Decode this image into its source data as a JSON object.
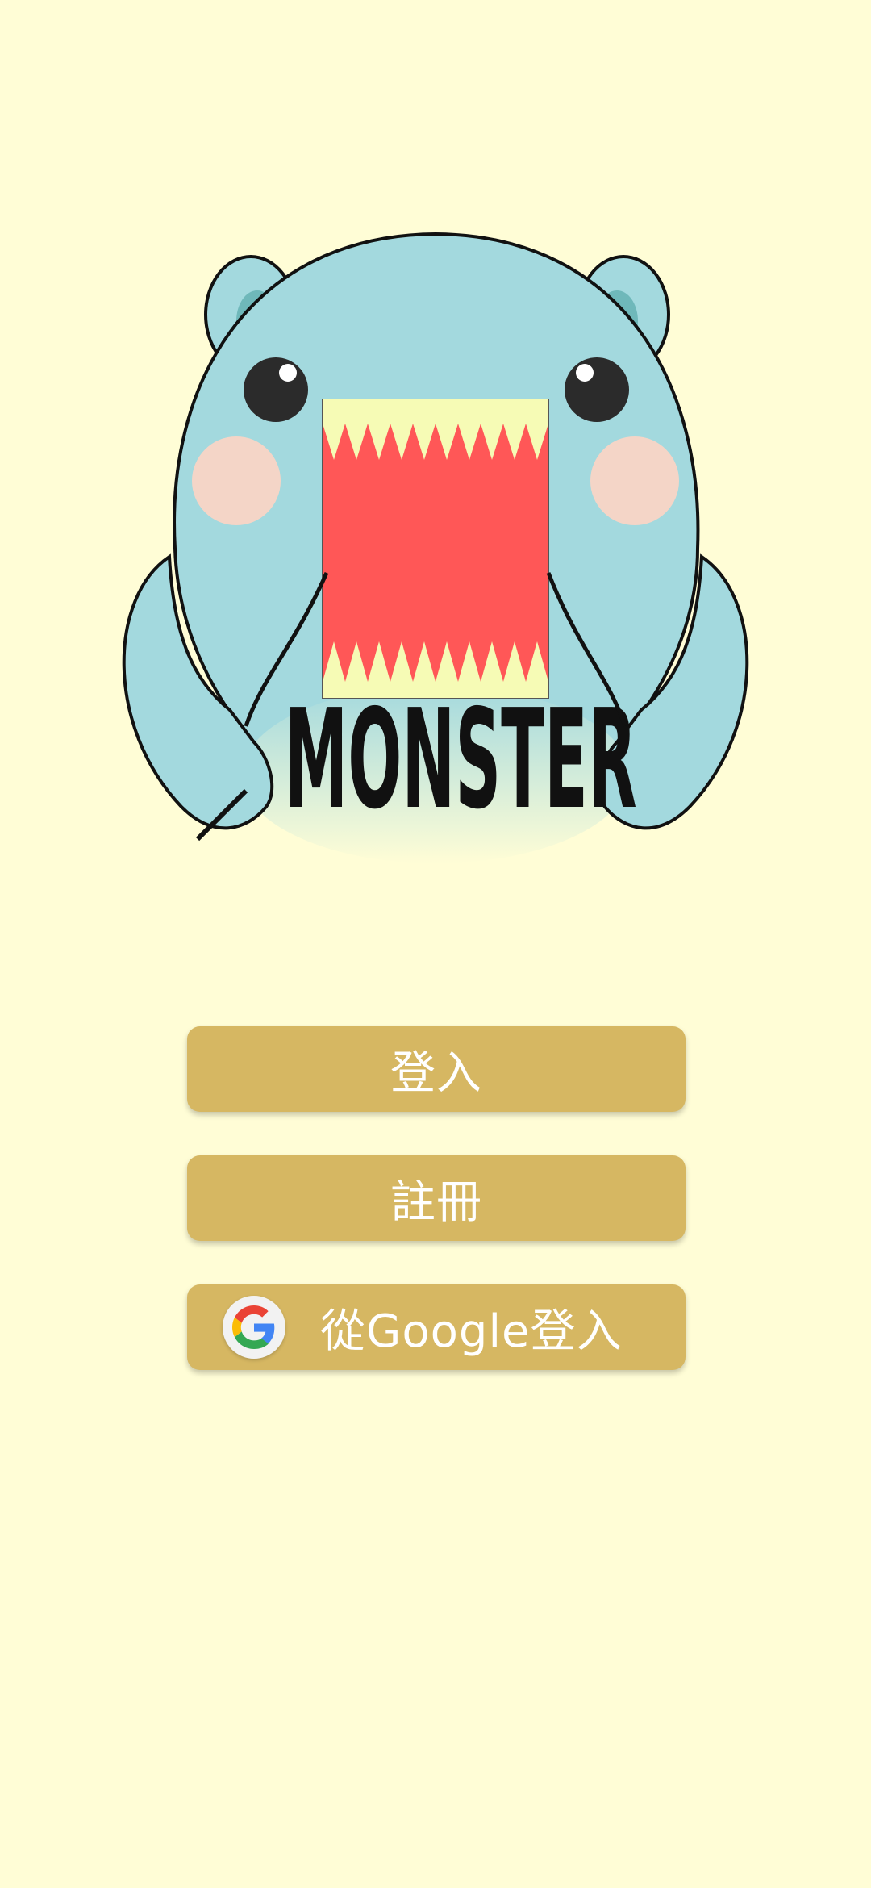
{
  "app": {
    "background_color": "#FFFDD6",
    "logo": {
      "icon": "monster-mascot-icon",
      "wordmark": "MONSTER"
    }
  },
  "buttons": {
    "login_label": "登入",
    "register_label": "註冊",
    "google_label": "從Google登入",
    "google_icon": "google-g-icon",
    "color": "#D6B762",
    "text_color": "#FFFFFF"
  }
}
